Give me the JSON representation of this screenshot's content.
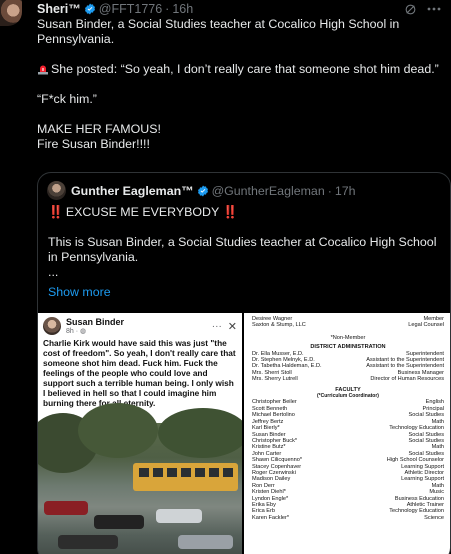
{
  "post": {
    "author_name": "Sheri™",
    "handle": "@FFT1776",
    "separator": "·",
    "time": "16h",
    "lines": [
      "Susan Binder, a Social Studies teacher at Cocalico High School in Pennsylvania.",
      "",
      "She posted: “So yeah, I don’t really care that someone shot him dead.”",
      "",
      "“F*ck him.”",
      "",
      "MAKE HER FAMOUS!",
      "Fire Susan Binder!!!!"
    ]
  },
  "quote": {
    "author_name": "Gunther Eagleman™",
    "handle": "@GuntherEagleman",
    "separator": "·",
    "time": "17h",
    "exclaim_left": "‼️",
    "headline": "EXCUSE ME EVERYBODY",
    "exclaim_right": "‼️",
    "body": "This is Susan Binder, a Social Studies teacher at Cocalico High School in Pennsylvania.",
    "ellipsis": "...",
    "show_more": "Show more"
  },
  "fb_post": {
    "name": "Susan Binder",
    "time": "8h · ",
    "dots": "···",
    "close": "✕",
    "text": "Charlie Kirk would have said this was just \"the cost of freedom\".  So yeah, I don't really care that someone shot him dead.  Fuck him. Fuck the feelings of the people who could love and support such a terrible human being.  I only wish I believed in hell so that I could imagine him burning there for all eternity."
  },
  "document": {
    "top_rows": [
      [
        "Desiree Wagner",
        "Member"
      ],
      [
        "Saxton & Stump, LLC",
        "Legal Counsel"
      ]
    ],
    "non_member": "*Non-Member",
    "district_admin_title": "DISTRICT ADMINISTRATION",
    "district_admin_rows": [
      [
        "Dr. Ella Musser, E.D.",
        "Superintendent"
      ],
      [
        "Dr. Stephen Melnyk, E.D.",
        "Assistant to the Superintendent"
      ],
      [
        "Dr. Tabetha Haldeman, E.D.",
        "Assistant to the Superintendent"
      ],
      [
        "Mrs. Sherri Stoll",
        "Business Manager"
      ],
      [
        "Mrs. Sherry Lutrell",
        "Director of Human Resources"
      ]
    ],
    "faculty_title": "FACULTY",
    "faculty_subtitle": "(*Curriculum Coordinator)",
    "faculty_rows": [
      [
        "Christopher Beiler",
        "English"
      ],
      [
        "Scott Benneth",
        "Principal"
      ],
      [
        "Michael Bertolino",
        "Social Studies"
      ],
      [
        "Jeffrey Bertz",
        "Math"
      ],
      [
        "Karl Bierly*",
        "Technology Education"
      ],
      [
        "Susan Binder",
        "Social Studies"
      ],
      [
        "Christopher Buck*",
        "Social Studies"
      ],
      [
        "Kristine Butz*",
        "Math"
      ],
      [
        "John Carter",
        "Social Studies"
      ],
      [
        "Shawn Cilicquenno*",
        "High School Counselor"
      ],
      [
        "Stacey Copenhaver",
        "Learning Support"
      ],
      [
        "Roger Czerwinski",
        "Athletic Director"
      ],
      [
        "Madison Dailey",
        "Learning Support"
      ],
      [
        "Ron Derr",
        "Math"
      ],
      [
        "Kristen Diehl*",
        "Music"
      ],
      [
        "Lyndon Engle*",
        "Business Education"
      ],
      [
        "Erika Eby",
        "Athletic Trainer"
      ],
      [
        "Erica Erb",
        "Technology Education"
      ],
      [
        "Karen Fackler*",
        "Science"
      ]
    ]
  },
  "colors": {
    "background": "#000000",
    "text": "#e7e9ea",
    "muted": "#71767b",
    "link": "#1d9bf0",
    "verified": "#1d9bf0",
    "border": "#2f3336",
    "alert": "#f4212e"
  }
}
